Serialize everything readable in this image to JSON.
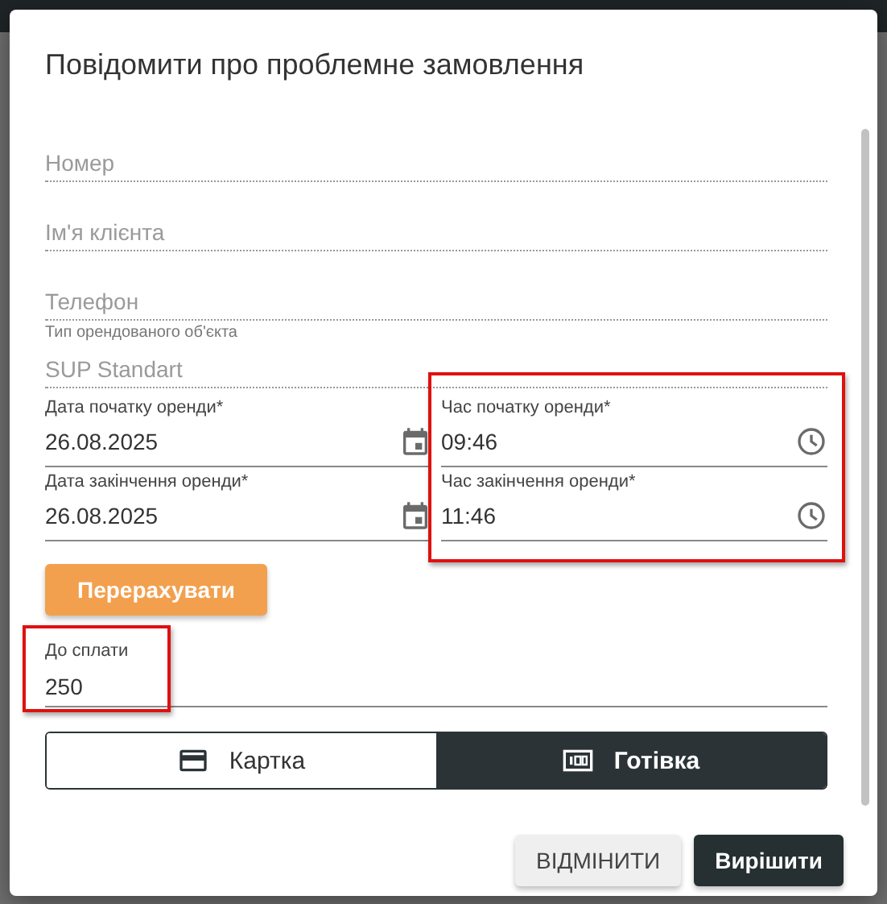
{
  "dialog": {
    "title": "Повідомити про проблемне замовлення"
  },
  "fields": [
    {
      "placeholder": "Номер",
      "disabled": true
    },
    {
      "placeholder": "Ім'я клієнта",
      "disabled": true
    },
    {
      "placeholder": "Телефон",
      "disabled": true
    },
    {
      "label": "Тип орендованого об'єкта",
      "value": "SUP Standart",
      "disabled": true
    }
  ],
  "dates": {
    "fields": [
      {
        "label": "Дата початку оренди*",
        "value": "26.08.2025",
        "kind": "date"
      },
      {
        "label": "Дата закінчення оренди*",
        "value": "26.08.2025",
        "kind": "date"
      }
    ]
  },
  "times": {
    "highlighted": true,
    "fields": [
      {
        "label": "Час початку оренди*",
        "value": "09:46",
        "kind": "time"
      },
      {
        "label": "Час закінчення оренди*",
        "value": "11:46",
        "kind": "time"
      }
    ]
  },
  "recalculate_button": "Перерахувати",
  "payment": {
    "label": "До сплати",
    "value": "250",
    "highlighted": true
  },
  "payment_methods": [
    {
      "label": "Картка",
      "kind": "card",
      "selected": false
    },
    {
      "label": "Готівка",
      "kind": "cash",
      "selected": true
    }
  ],
  "buttons": [
    {
      "label": "ВІДМІНИТИ",
      "kind": "secondary"
    },
    {
      "label": "Вирішити",
      "kind": "primary"
    }
  ]
}
